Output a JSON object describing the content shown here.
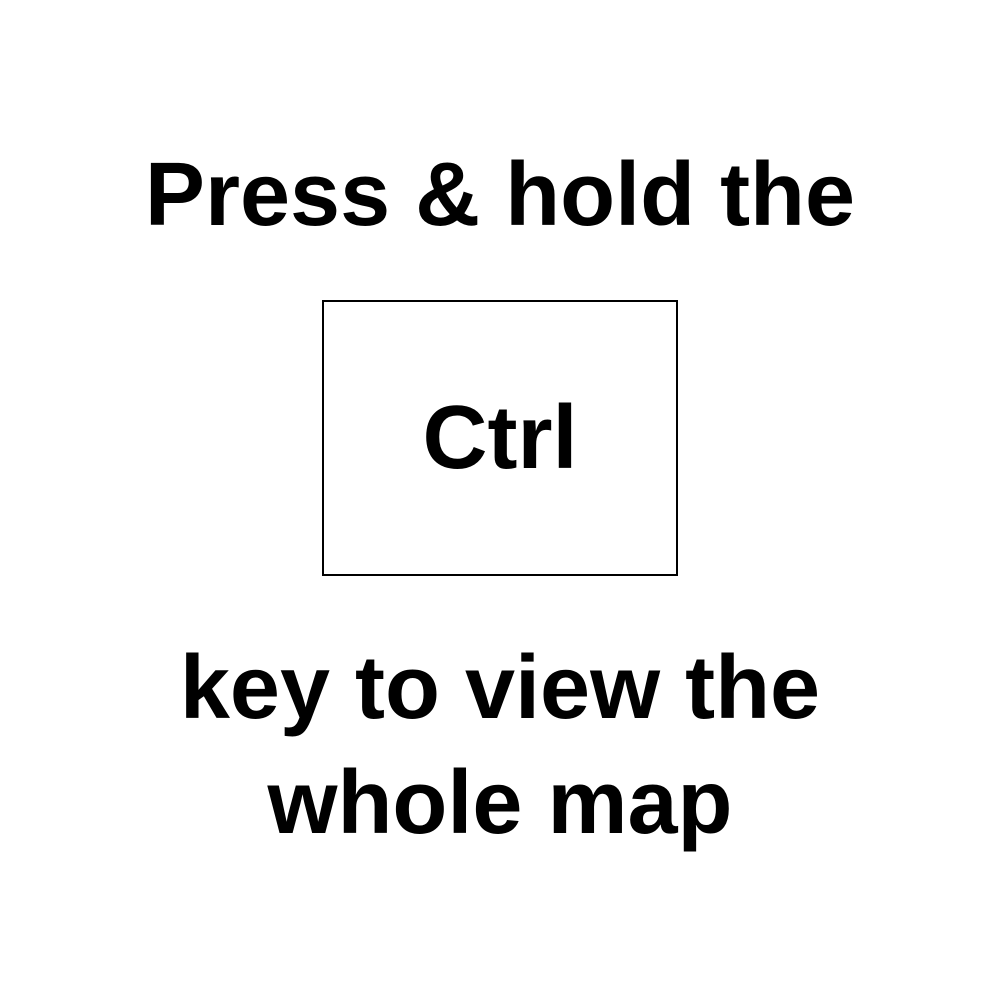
{
  "instruction": {
    "line_top": "Press & hold the",
    "key_label": "Ctrl",
    "line_bottom_1": "key to view the",
    "line_bottom_2": "whole map"
  },
  "colors": {
    "background": "#ffffff",
    "text": "#000000",
    "key_border": "#000000"
  }
}
